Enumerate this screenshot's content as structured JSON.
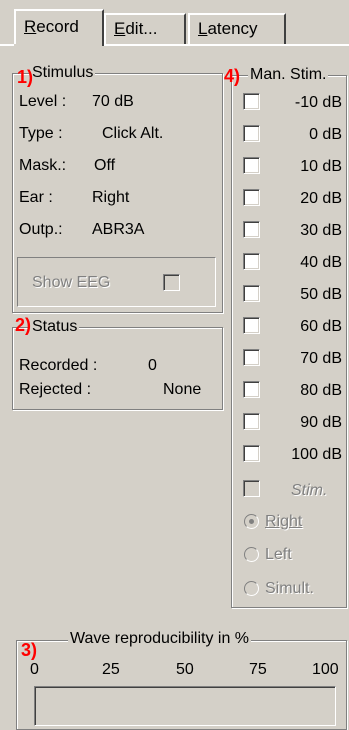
{
  "tabs": [
    {
      "label_first": "R",
      "label_rest": "ecord"
    },
    {
      "label_first": "E",
      "label_rest": "dit..."
    },
    {
      "label_first": "L",
      "label_rest": "atency"
    }
  ],
  "stimulus": {
    "marker": "1)",
    "title": "Stimulus",
    "rows": [
      {
        "label": "Level :",
        "value": "70 dB"
      },
      {
        "label": "Type :",
        "value": "Click Alt."
      },
      {
        "label": "Mask.:",
        "value": "Off"
      },
      {
        "label": "Ear :",
        "value": "Right"
      },
      {
        "label": "Outp.:",
        "value": "ABR3A"
      }
    ],
    "show_eeg_label": "Show EEG"
  },
  "status": {
    "marker": "2)",
    "title": "Status",
    "recorded_label": "Recorded :",
    "recorded_value": "0",
    "rejected_label": "Rejected :",
    "rejected_value": "None"
  },
  "man_stim": {
    "marker": "4)",
    "title": "Man. Stim.",
    "levels": [
      "-10 dB",
      "0 dB",
      "10 dB",
      "20 dB",
      "30 dB",
      "40 dB",
      "50 dB",
      "60 dB",
      "70 dB",
      "80 dB",
      "90 dB",
      "100 dB"
    ],
    "stim_label": "Stim.",
    "radio_right": "Right",
    "radio_left": "Left",
    "radio_simult": "Simult."
  },
  "wave": {
    "marker": "3)",
    "title": "Wave reproducibility in %",
    "ticks": [
      "0",
      "25",
      "50",
      "75",
      "100"
    ]
  }
}
